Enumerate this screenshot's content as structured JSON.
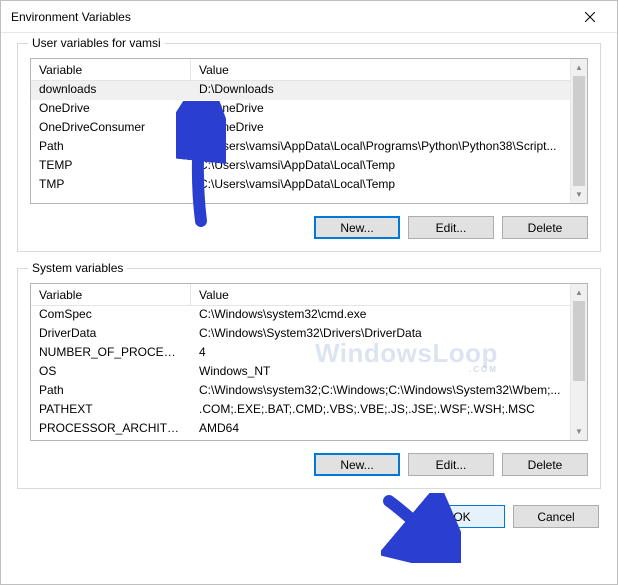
{
  "window": {
    "title": "Environment Variables"
  },
  "user_group": {
    "label": "User variables for vamsi",
    "columns": {
      "var": "Variable",
      "val": "Value"
    },
    "rows": [
      {
        "var": "downloads",
        "val": "D:\\Downloads",
        "selected": true
      },
      {
        "var": "OneDrive",
        "val": "F:\\OneDrive",
        "selected": false
      },
      {
        "var": "OneDriveConsumer",
        "val": "F:\\OneDrive",
        "selected": false
      },
      {
        "var": "Path",
        "val": "C:\\Users\\vamsi\\AppData\\Local\\Programs\\Python\\Python38\\Script...",
        "selected": false
      },
      {
        "var": "TEMP",
        "val": "C:\\Users\\vamsi\\AppData\\Local\\Temp",
        "selected": false
      },
      {
        "var": "TMP",
        "val": "C:\\Users\\vamsi\\AppData\\Local\\Temp",
        "selected": false
      }
    ],
    "buttons": {
      "new": "New...",
      "edit": "Edit...",
      "delete": "Delete"
    }
  },
  "system_group": {
    "label": "System variables",
    "columns": {
      "var": "Variable",
      "val": "Value"
    },
    "rows": [
      {
        "var": "ComSpec",
        "val": "C:\\Windows\\system32\\cmd.exe"
      },
      {
        "var": "DriverData",
        "val": "C:\\Windows\\System32\\Drivers\\DriverData"
      },
      {
        "var": "NUMBER_OF_PROCESSORS",
        "val": "4"
      },
      {
        "var": "OS",
        "val": "Windows_NT"
      },
      {
        "var": "Path",
        "val": "C:\\Windows\\system32;C:\\Windows;C:\\Windows\\System32\\Wbem;..."
      },
      {
        "var": "PATHEXT",
        "val": ".COM;.EXE;.BAT;.CMD;.VBS;.VBE;.JS;.JSE;.WSF;.WSH;.MSC"
      },
      {
        "var": "PROCESSOR_ARCHITECTURE",
        "val": "AMD64"
      }
    ],
    "buttons": {
      "new": "New...",
      "edit": "Edit...",
      "delete": "Delete"
    }
  },
  "footer": {
    "ok": "OK",
    "cancel": "Cancel"
  },
  "watermark": "WindowsLoop",
  "watermark_sub": ".COM"
}
